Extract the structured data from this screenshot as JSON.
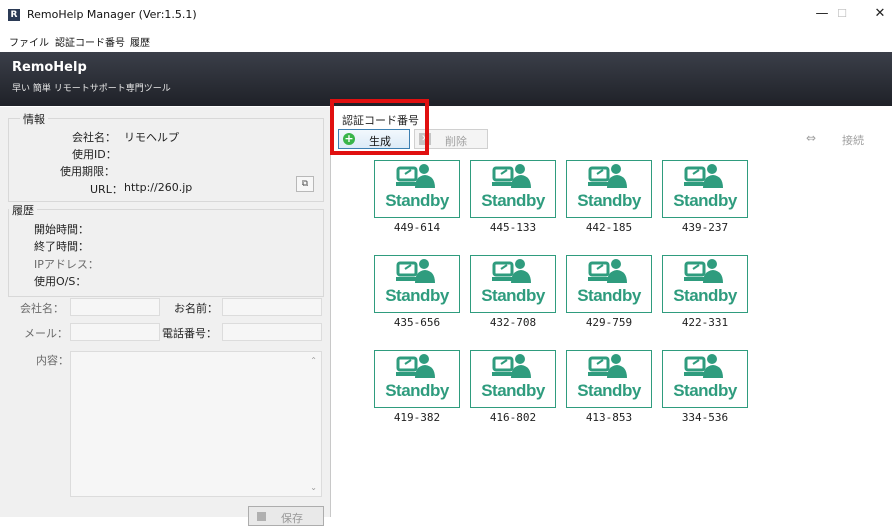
{
  "window": {
    "title": "RemoHelp Manager (Ver:1.5.1)",
    "app_icon_letter": "R",
    "minimize": "—",
    "maximize": "☐",
    "close": "✕"
  },
  "menu": [
    "ファイル",
    "認証コード番号",
    "履歴"
  ],
  "banner": {
    "title": "RemoHelp",
    "subtitle": "早い 簡単 リモートサポート専門ツール"
  },
  "info": {
    "title": "情報",
    "company_label": "会社名：",
    "company_value": "リモヘルプ",
    "user_id_label": "使用ID：",
    "expiry_label": "使用期限：",
    "url_label": "URL：",
    "url_value": "http://260.jp"
  },
  "history": {
    "title": "履歴",
    "start_label": "開始時間：",
    "end_label": "終了時間：",
    "ip_label": "IPアドレス：",
    "os_label": "使用O/S：",
    "company_label": "会社名：",
    "name_label": "お名前：",
    "mail_label": "メール：",
    "phone_label": "電話番号：",
    "content_label": "内容：",
    "save_label": "保存"
  },
  "codes_panel": {
    "title": "認証コード番号",
    "generate_label": "生成",
    "delete_label": "削除",
    "connect_label": "接続",
    "status_text": "Standby",
    "tiles": [
      [
        "449-614",
        "445-133",
        "442-185",
        "439-237"
      ],
      [
        "435-656",
        "432-708",
        "429-759",
        "422-331"
      ],
      [
        "419-382",
        "416-802",
        "413-853",
        "334-536"
      ]
    ]
  },
  "colors": {
    "accent": "#2f9c7e",
    "highlight": "#e01010",
    "banner": "#2a2d35"
  }
}
